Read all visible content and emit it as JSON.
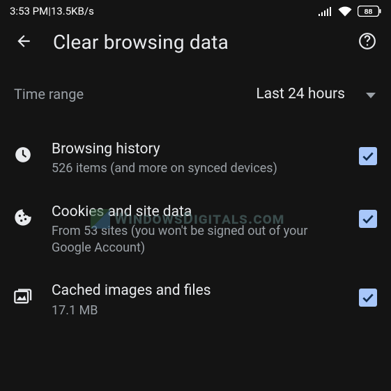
{
  "status_bar": {
    "time": "3:53 PM",
    "separator": " | ",
    "net_speed": "13.5KB/s",
    "battery_percent": "88"
  },
  "header": {
    "title": "Clear browsing data"
  },
  "time_range": {
    "label": "Time range",
    "selected": "Last 24 hours"
  },
  "options": [
    {
      "icon": "clock",
      "title": "Browsing history",
      "subtitle": "526 items (and more on synced devices)",
      "checked": true
    },
    {
      "icon": "cookie",
      "title": "Cookies and site data",
      "subtitle": "From 53 sites (you won't be signed out of your Google Account)",
      "checked": true
    },
    {
      "icon": "images",
      "title": "Cached images and files",
      "subtitle": "17.1 MB",
      "checked": true
    }
  ],
  "watermark": {
    "text": "WindowsDigitals.com"
  }
}
